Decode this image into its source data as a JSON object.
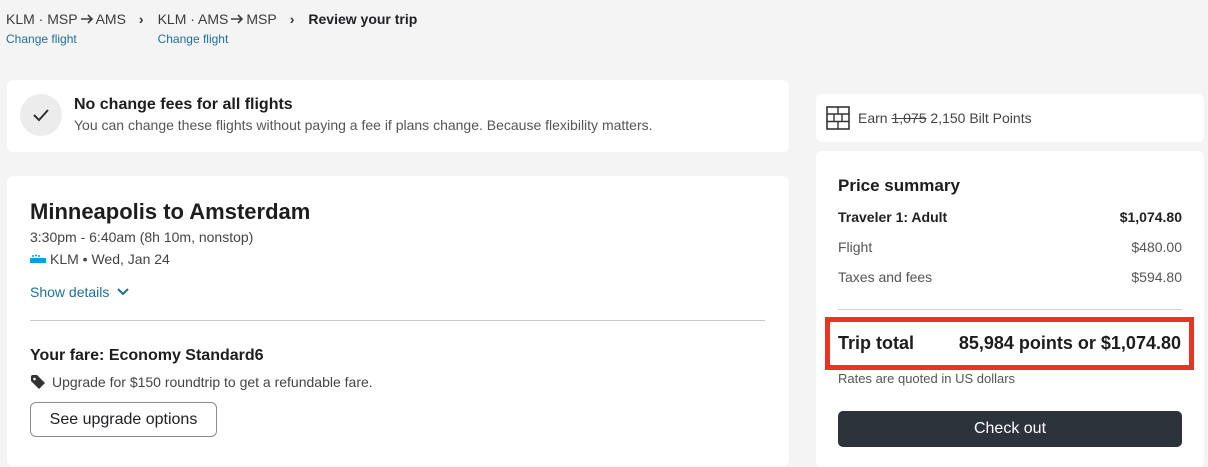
{
  "breadcrumb": {
    "step1": {
      "airline": "KLM · MSP",
      "dest": "AMS",
      "link": "Change flight"
    },
    "step2": {
      "airline": "KLM · AMS",
      "dest": "MSP",
      "link": "Change flight"
    },
    "current": "Review your trip"
  },
  "notice": {
    "title": "No change fees for all flights",
    "subtitle": "You can change these flights without paying a fee if plans change. Because flexibility matters."
  },
  "trip": {
    "title": "Minneapolis to Amsterdam",
    "times": "3:30pm - 6:40am (8h 10m, nonstop)",
    "airline": "KLM • Wed, Jan 24",
    "show_details": "Show details",
    "fare_title": "Your fare: Economy Standard6",
    "upgrade_text": "Upgrade for $150 roundtrip to get a refundable fare.",
    "upgrade_button": "See upgrade options"
  },
  "earn": {
    "prefix": "Earn",
    "old_points": "1,075",
    "new_points": "2,150 Bilt Points"
  },
  "summary": {
    "title": "Price summary",
    "rows": [
      {
        "label": "Traveler 1: Adult",
        "value": "$1,074.80"
      },
      {
        "label": "Flight",
        "value": "$480.00"
      },
      {
        "label": "Taxes and fees",
        "value": "$594.80"
      }
    ],
    "total_label": "Trip total",
    "total_value": "85,984 points or $1,074.80",
    "rates_note": "Rates are quoted in US dollars",
    "checkout": "Check out"
  },
  "colors": {
    "link": "#1f6f9a",
    "highlight_box": "#ea3323",
    "checkout_bg": "#2c333b",
    "klm_blue": "#00a1de"
  },
  "icons": {
    "check": "check-icon",
    "arrow": "arrow-right-icon",
    "chevron_right": "chevron-right-icon",
    "chevron_down": "chevron-down-icon",
    "tag": "tag-icon",
    "building": "building-icon",
    "airline_logo": "klm-logo-icon"
  }
}
